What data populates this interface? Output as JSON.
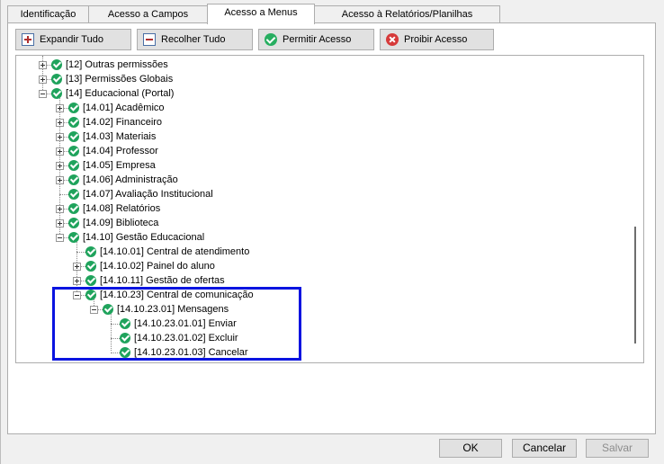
{
  "tabs": [
    {
      "label": "Identificação"
    },
    {
      "label": "Acesso a Campos"
    },
    {
      "label": "Acesso a Menus"
    },
    {
      "label": "Acesso à Relatórios/Planilhas"
    }
  ],
  "toolbar": {
    "expand_label": "Expandir Tudo",
    "collapse_label": "Recolher Tudo",
    "allow_label": "Permitir Acesso",
    "deny_label": "Proibir Acesso"
  },
  "tree": {
    "nodes": [
      {
        "label": "[12] Outras permissões",
        "state": "collapsed"
      },
      {
        "label": "[13] Permissões Globais",
        "state": "collapsed"
      },
      {
        "label": "[14] Educacional (Portal)",
        "state": "expanded"
      },
      {
        "label": "[14.01] Acadêmico",
        "state": "collapsed"
      },
      {
        "label": "[14.02] Financeiro",
        "state": "collapsed"
      },
      {
        "label": "[14.03] Materiais",
        "state": "collapsed"
      },
      {
        "label": "[14.04] Professor",
        "state": "collapsed"
      },
      {
        "label": "[14.05] Empresa",
        "state": "collapsed"
      },
      {
        "label": "[14.06] Administração",
        "state": "collapsed"
      },
      {
        "label": "[14.07] Avaliação Institucional",
        "state": "leaf"
      },
      {
        "label": "[14.08] Relatórios",
        "state": "collapsed"
      },
      {
        "label": "[14.09] Biblioteca",
        "state": "collapsed"
      },
      {
        "label": "[14.10] Gestão Educacional",
        "state": "expanded"
      },
      {
        "label": "[14.10.01] Central de atendimento",
        "state": "leaf"
      },
      {
        "label": "[14.10.02] Painel do aluno",
        "state": "collapsed"
      },
      {
        "label": "[14.10.11] Gestão de ofertas",
        "state": "collapsed"
      },
      {
        "label": "[14.10.23] Central de comunicação",
        "state": "expanded"
      },
      {
        "label": "[14.10.23.01] Mensagens",
        "state": "expanded"
      },
      {
        "label": "[14.10.23.01.01] Enviar",
        "state": "leaf"
      },
      {
        "label": "[14.10.23.01.02] Excluir",
        "state": "leaf"
      },
      {
        "label": "[14.10.23.01.03] Cancelar",
        "state": "leaf"
      }
    ]
  },
  "footer": {
    "ok_label": "OK",
    "cancel_label": "Cancelar",
    "save_label": "Salvar"
  },
  "colors": {
    "check": "#1fa35c",
    "highlight_border": "#0a14e0",
    "deny": "#d63a3a"
  }
}
